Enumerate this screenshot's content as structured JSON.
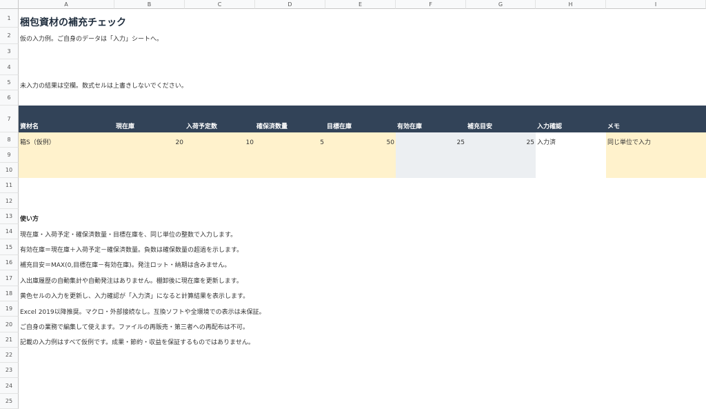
{
  "columns": [
    "A",
    "B",
    "C",
    "D",
    "E",
    "F",
    "G",
    "H",
    "I"
  ],
  "rows": [
    "1",
    "2",
    "3",
    "4",
    "5",
    "6",
    "7",
    "8",
    "9",
    "10",
    "11",
    "12",
    "13",
    "14",
    "15",
    "16",
    "17",
    "18",
    "19",
    "20",
    "21",
    "22",
    "23",
    "24",
    "25"
  ],
  "title": "梱包資材の補充チェック",
  "subtitle": "仮の入力例。ご自身のデータは「入力」シートへ。",
  "note": "未入力の結果は空欄。数式セルは上書きしないでください。",
  "table": {
    "headers": [
      "資材名",
      "現在庫",
      "入荷予定数",
      "確保済数量",
      "目標在庫",
      "有効在庫",
      "補充目安",
      "入力確認",
      "メモ"
    ],
    "row": {
      "name": "箱S（仮例）",
      "current": "20",
      "incoming": "10",
      "reserved": "5",
      "target": "50",
      "available": "25",
      "reorder": "25",
      "check": "入力済",
      "memo": "同じ単位で入力"
    }
  },
  "usage": {
    "heading": "使い方",
    "lines": [
      "現在庫・入荷予定・確保済数量・目標在庫を、同じ単位の整数で入力します。",
      "有効在庫＝現在庫＋入荷予定－確保済数量。負数は確保数量の超過を示します。",
      "補充目安＝MAX(0,目標在庫－有効在庫)。発注ロット・納期は含みません。",
      "入出庫履歴の自動集計や自動発注はありません。棚卸後に現在庫を更新します。",
      "黄色セルの入力を更新し、入力確認が「入力済」になると計算結果を表示します。",
      "Excel 2019以降推奨。マクロ・外部接続なし。互換ソフトや全環境での表示は未保証。",
      "ご自身の業務で編集して使えます。ファイルの再販売・第三者への再配布は不可。",
      "記載の入力例はすべて仮例です。成果・節約・収益を保証するものではありません。"
    ]
  },
  "colors": {
    "header_band": "#324358",
    "input_fill": "#fff2cc",
    "calc_fill": "#eceff2"
  }
}
